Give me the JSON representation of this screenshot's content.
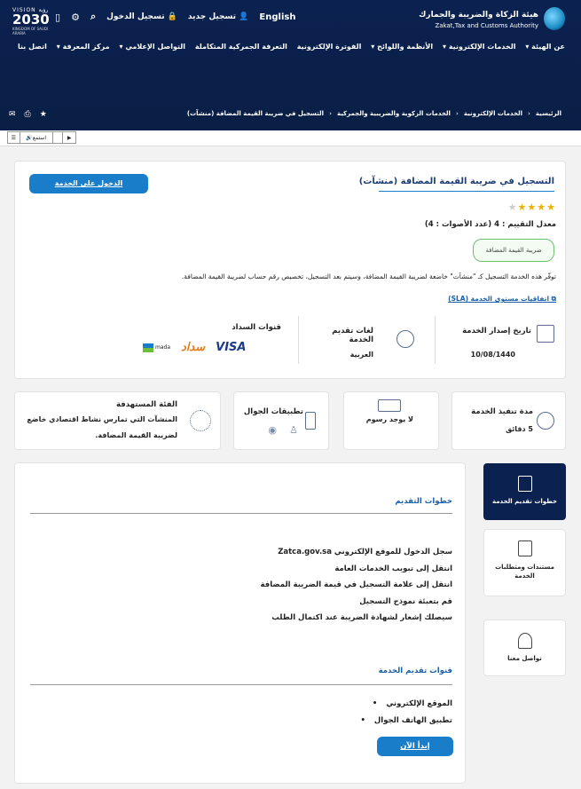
{
  "header": {
    "org_name_ar": "هيئة الزكاة والضريبة والجمارك",
    "org_name_en": "Zakat,Tax and Customs Authority",
    "vision": {
      "top": "VISION رؤية",
      "year": "2030",
      "sub": "KINGDOM OF SAUDI ARABIA"
    },
    "topbar": {
      "login": "تسجيل الدخول",
      "register": "تسجيل جديد",
      "language": "English"
    },
    "nav": [
      "عن الهيئة",
      "الخدمات الإلكترونية",
      "الأنظمة واللوائح",
      "الفوترة الإلكترونية",
      "التعرفة الجمركية المتكاملة",
      "التواصل الإعلامي",
      "مركز المعرفة",
      "اتصل بنا"
    ],
    "breadcrumb": [
      "الرئيسية",
      "الخدمات الإلكترونية",
      "الخدمات الزكوية والضريبية والجمركية",
      "التسجيل في ضريبة القيمة المضافة (منشآت)"
    ]
  },
  "accessibility": {
    "listen_label": "استمع"
  },
  "service": {
    "title": "التسجيل في ضريبة القيمة المضافة (منشآت)",
    "login_button": "الدخول على الخدمة",
    "rating_stars": 4,
    "rating_max": 5,
    "rating_text": "معدل التقييم : 4 (عدد الأصوات : 4)",
    "tag": "ضريبة القيمة المضافة",
    "description": "توفّر هذه الخدمة التسجيل كـ \"منشآت\" خاضعة لضريبة القيمة المضافة، وسيتم بعد التسجيل، تخصيص رقم حساب لضريبة القيمة المضافة.",
    "sla_link": "اتفاقيات مستوى الخدمة (SLA)",
    "issue_date_label": "تاريخ إصدار الخدمة",
    "issue_date": "10/08/1440",
    "languages_label": "لغات تقديم الخدمة",
    "languages": "العربية",
    "payment_label": "قنوات السداد",
    "payment_methods": [
      "VISA",
      "سداد",
      "mada"
    ]
  },
  "details": {
    "duration_label": "مدة تنفيذ الخدمة",
    "duration": "5 دقائق",
    "fees": "لا يوجد رسوم",
    "apps_label": "تطبيقات الجوال",
    "audience_label": "الفئة المستهدفة",
    "audience_line1": "المنشآت التي تمارس نشاط اقتصادي خاضع",
    "audience_line2": "لضريبة القيمة المضافة."
  },
  "tabs": [
    {
      "label": "خطوات تقديم الخدمة"
    },
    {
      "label": "مستندات ومتطلبات الخدمة"
    },
    {
      "label": "تواصل معنا"
    }
  ],
  "steps": {
    "title": "خطوات التقديم",
    "items": [
      "سجل الدخول للموقع الإلكتروني Zatca.gov.sa",
      "انتقل إلى تبويب الخدمات العامة",
      "انتقل إلى علامة التسجيل في قيمة الضريبة المضافة",
      "قم بتعبئة نموذج التسجيل",
      "سيصلك إشعار لشهادة الضريبة عند اكتمال الطلب"
    ],
    "channels_title": "قنوات تقديم الخدمة",
    "channels": [
      "الموقع الإلكتروني",
      "تطبيق الهاتف الجوال"
    ],
    "start_button": "إبدأ الآن"
  }
}
